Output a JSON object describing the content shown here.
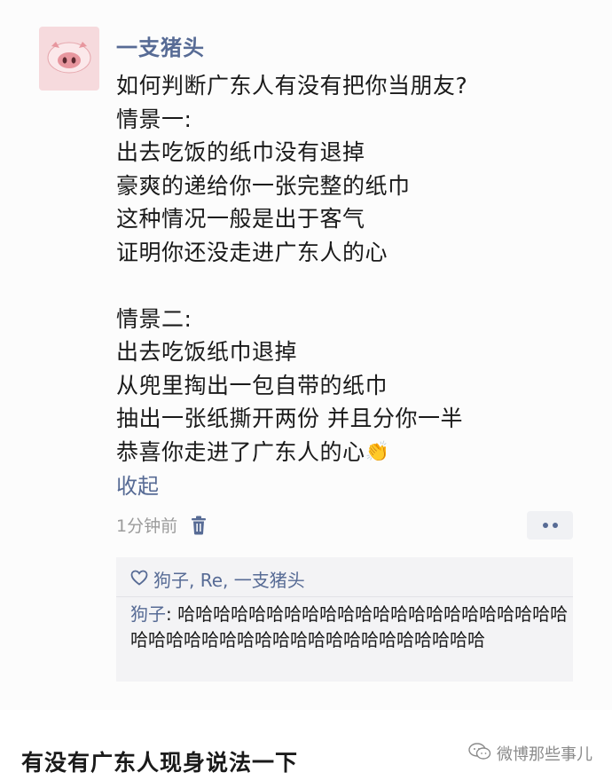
{
  "user": {
    "name": "一支猪头",
    "avatar_icon": "pig-face-icon",
    "avatar_color": "#f6dadd"
  },
  "post": {
    "lines": [
      "如何判断广东人有没有把你当朋友?",
      "情景一:",
      "出去吃饭的纸巾没有退掉",
      "豪爽的递给你一张完整的纸巾",
      "这种情况一般是出于客气",
      "证明你还没走进广东人的心",
      "",
      "情景二:",
      "出去吃饭纸巾退掉",
      "从兜里掏出一包自带的纸巾",
      "抽出一张纸撕开两份 并且分你一半",
      "恭喜你走进了广东人的心"
    ],
    "last_line_emoji": "👏",
    "collapse_label": "收起",
    "timestamp": "1分钟前",
    "delete_icon": "trash-icon",
    "more_icon": "more-dots-icon"
  },
  "interactions": {
    "like_icon": "heart-outline-icon",
    "likes": "狗子, Re, 一支猪头",
    "comments": [
      {
        "author": "狗子",
        "separator": ": ",
        "text": "哈哈哈哈哈哈哈哈哈哈哈哈哈哈哈哈哈哈哈哈哈哈哈哈哈哈哈哈哈哈哈哈哈哈哈哈哈哈哈哈哈哈"
      }
    ]
  },
  "caption": "有没有广东人现身说法一下",
  "watermark": {
    "icon": "wechat-chat-icon",
    "text": "微博那些事儿"
  },
  "colors": {
    "link_blue": "#576b95",
    "meta_gray": "#9b9b9b",
    "comment_bg": "#f3f3f5"
  }
}
